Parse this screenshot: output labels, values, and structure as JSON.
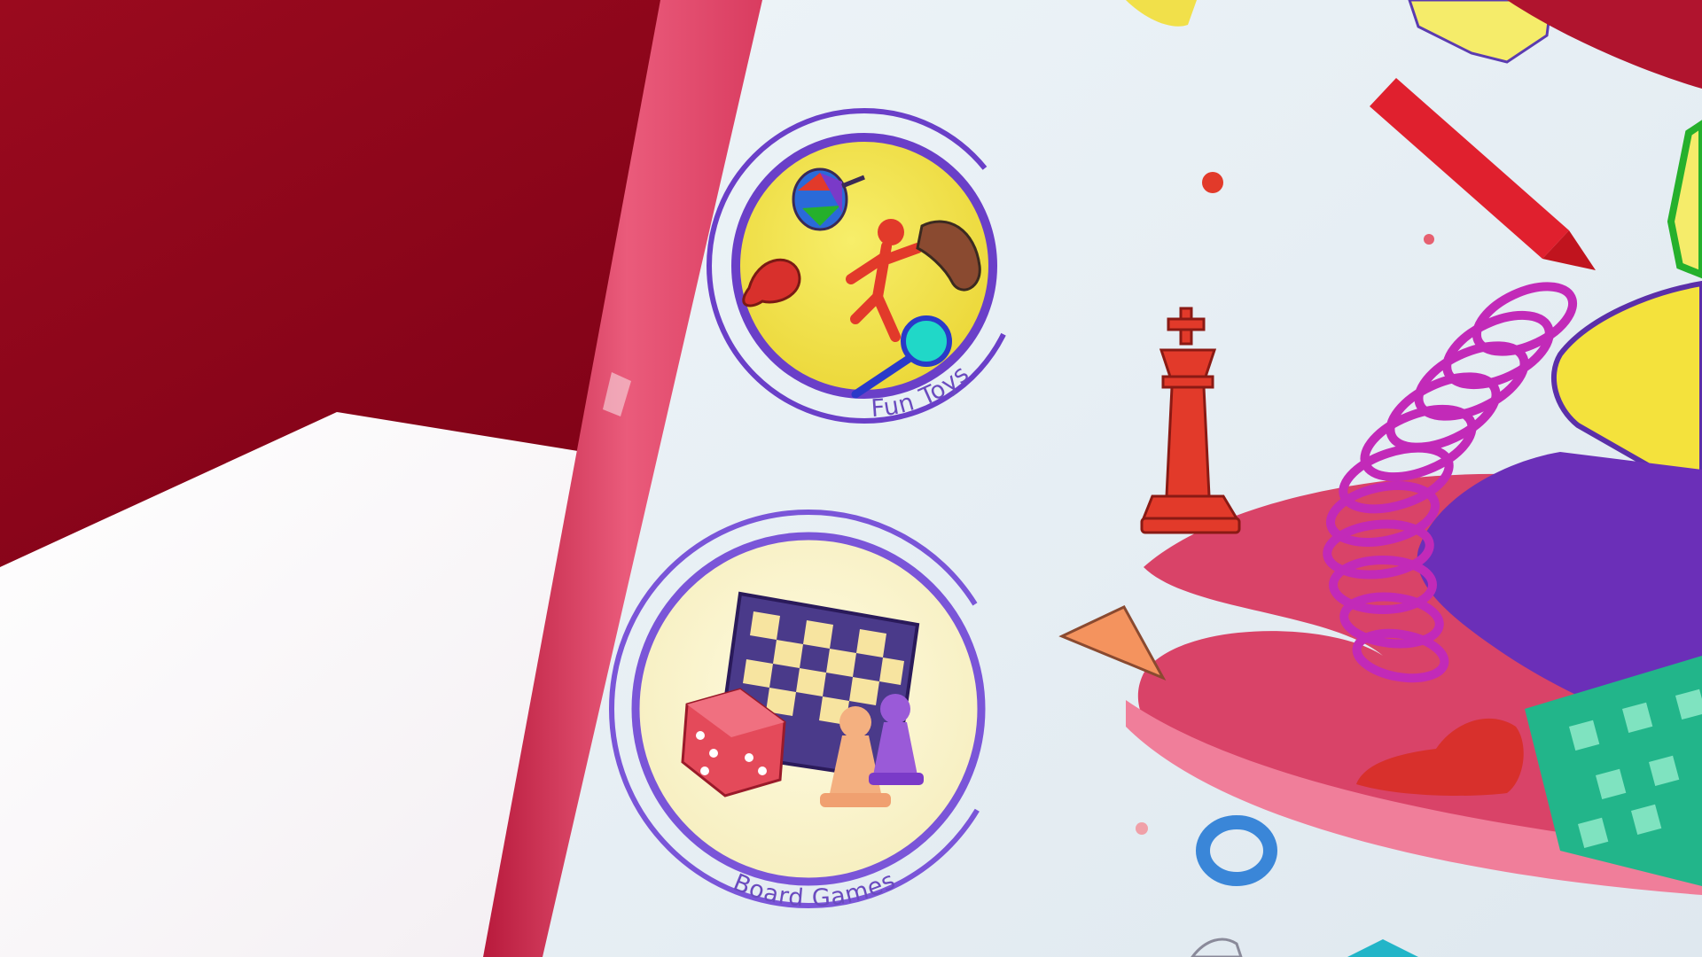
{
  "badges": [
    {
      "id": "fun-toys",
      "caption": "Fun Toys"
    },
    {
      "id": "board-games",
      "caption": "Board Games"
    }
  ],
  "colors": {
    "backdrop_red": "#8a0018",
    "box_edge_pink": "#e04a6c",
    "box_panel": "#e6eef4",
    "ring_purple": "#6a3fc8",
    "badge_yellow": "#f2e24a",
    "badge_cream": "#fbf4c8",
    "chess_red": "#e23a2a",
    "spring_magenta": "#c22ab8",
    "ribbon_pink": "#e2577a",
    "tile_purple": "#6b2fb8",
    "board_teal": "#22b58a"
  }
}
